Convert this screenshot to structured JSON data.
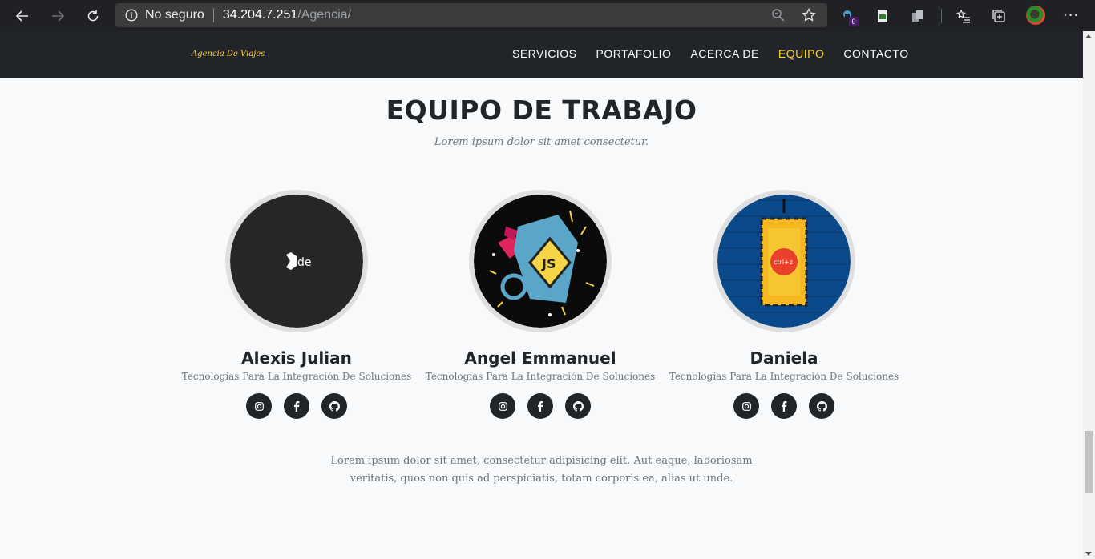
{
  "browser": {
    "insecure_label": "No seguro",
    "url_host": "34.204.7.251",
    "url_path": "/Agencia/",
    "extension_badge": "0"
  },
  "site": {
    "brand": "Agencia De Viajes",
    "nav": [
      {
        "label": "Servicios"
      },
      {
        "label": "Portafolio"
      },
      {
        "label": "Acerca de"
      },
      {
        "label": "Equipo"
      },
      {
        "label": "Contacto"
      }
    ],
    "active_color": "#fed136"
  },
  "team": {
    "title": "EQUIPO DE TRABAJO",
    "subtitle": "Lorem ipsum dolor sit amet consectetur.",
    "members": [
      {
        "name": "Alexis Julian",
        "role": "Tecnologías Para La Integración De Soluciones",
        "photo_text": "de"
      },
      {
        "name": "Angel Emmanuel",
        "role": "Tecnologías Para La Integración De Soluciones",
        "photo_text": "JS"
      },
      {
        "name": "Daniela",
        "role": "Tecnologías Para La Integración De Soluciones",
        "photo_text": "ctrl+z"
      }
    ],
    "social_icons": [
      "instagram-icon",
      "facebook-icon",
      "github-icon"
    ],
    "footer_text": "Lorem ipsum dolor sit amet, consectetur adipisicing elit. Aut eaque, laboriosam veritatis, quos non quis ad perspiciatis, totam corporis ea, alias ut unde."
  }
}
